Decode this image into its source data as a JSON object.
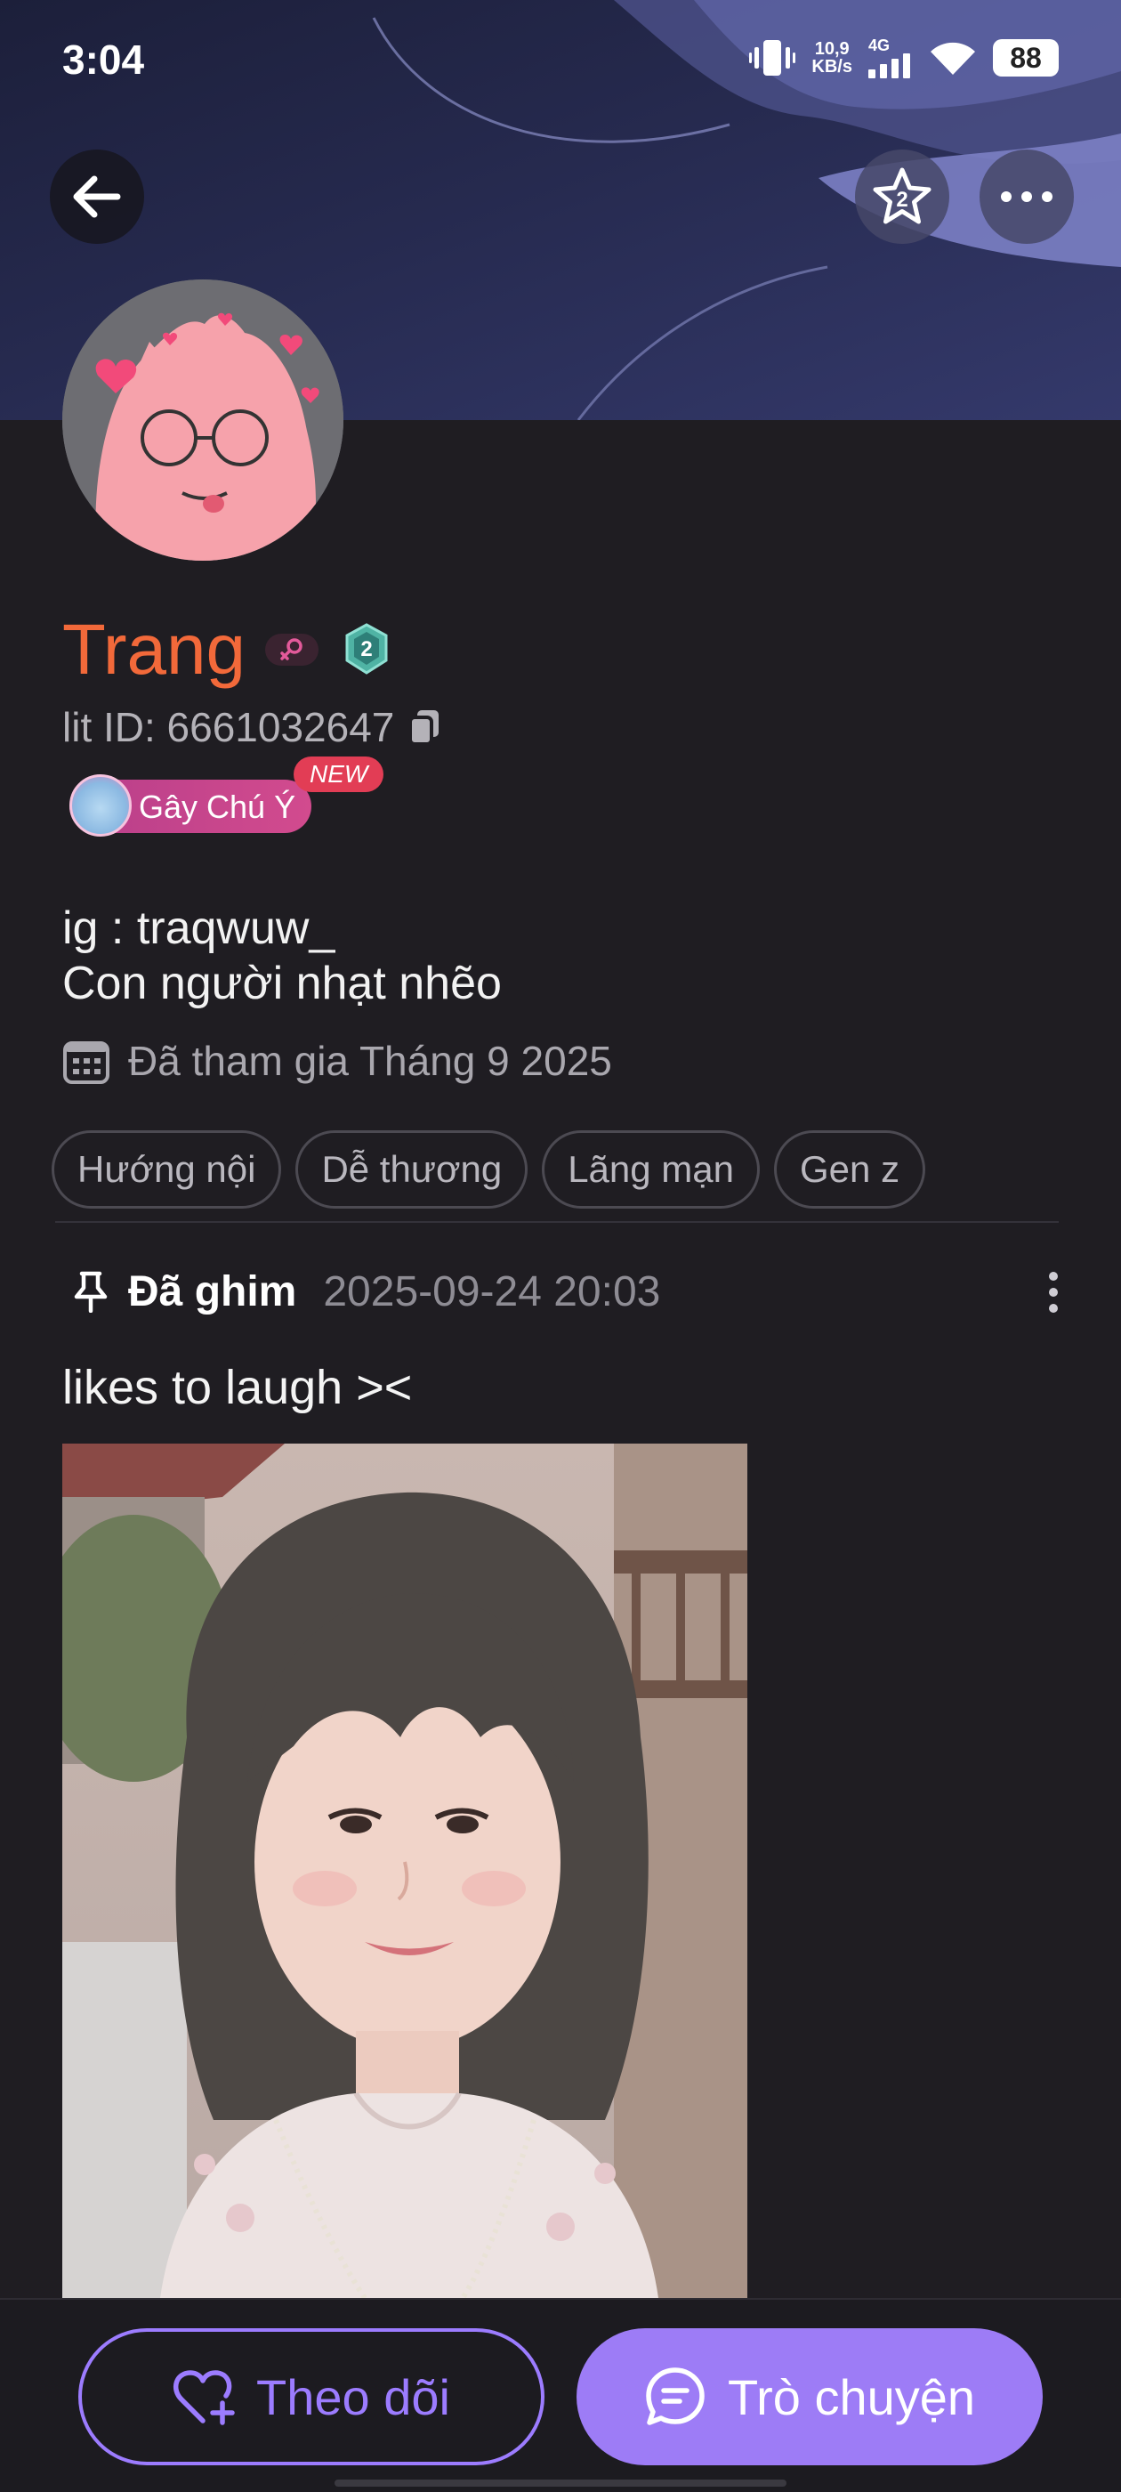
{
  "status_bar": {
    "time": "3:04",
    "net_speed_value": "10,9",
    "net_speed_unit": "KB/s",
    "network_gen": "4G",
    "battery": "88"
  },
  "header": {
    "back_icon": "arrow-left-icon",
    "star_icon": "star-level-icon",
    "star_level": "2",
    "more_icon": "more-horizontal-icon"
  },
  "profile": {
    "name": "Trang",
    "level": "2",
    "lit_id": "lit ID: 6661032647",
    "badge_label": "Gây Chú Ý",
    "badge_new": "NEW",
    "bio_lines": [
      "ig : traqwuw_",
      "Con người nhạt nhẽo"
    ],
    "joined": "Đã tham gia Tháng 9 2025",
    "tags": [
      "Hướng nội",
      "Dễ thương",
      "Lãng mạn",
      "Gen z"
    ]
  },
  "post": {
    "pinned_label": "Đã ghim",
    "date": "2025-09-24 20:03",
    "text": "likes to laugh ><"
  },
  "actions": {
    "follow_label": "Theo dõi",
    "chat_label": "Trò chuyện"
  },
  "colors": {
    "name": "#f2693a",
    "accent": "#9d7cf6",
    "background": "#1f1d22",
    "badge": "#d24b8e",
    "new_tag": "#e23d55"
  }
}
